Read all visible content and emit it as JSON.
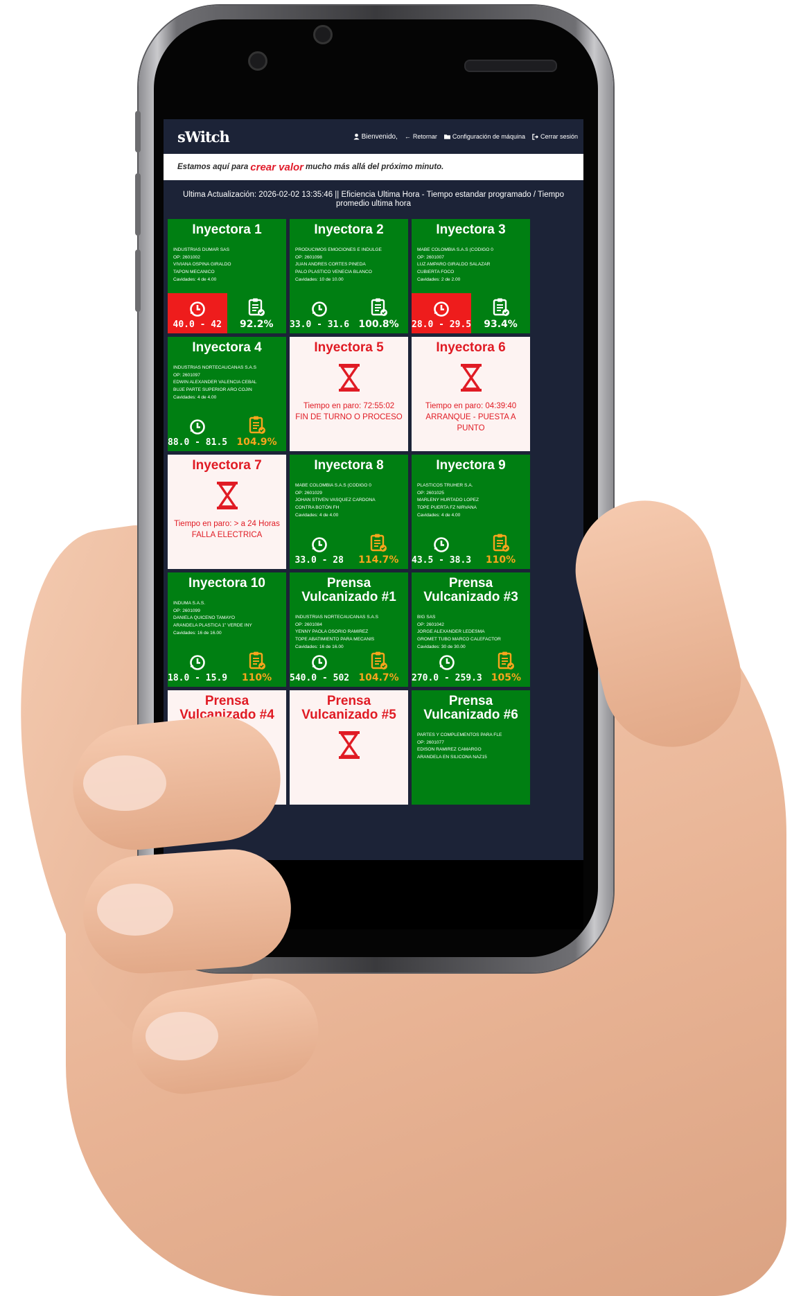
{
  "header": {
    "logo": "sWitch",
    "welcome": "Bienvenido,",
    "back": "Retornar",
    "machine_config": "Configuración de máquina",
    "logout": "Cerrar sesión"
  },
  "slogan": {
    "prefix": "Estamos aquí para",
    "highlight": "crear valor",
    "suffix": "mucho más allá del próximo minuto."
  },
  "update_bar": "Ultima Actualización: 2026-02-02 13:35:46 || Eficiencia Ultima Hora - Tiempo estandar programado / Tiempo promedio ultima hora",
  "colors": {
    "running": "#007f12",
    "alarm": "#ee1c1c",
    "stopped_bg": "#fdf3f2",
    "stopped_text": "#e01b24",
    "efficiency_over": "#f7a51d",
    "navbar": "#1c2337"
  },
  "icons": {
    "user": "user-icon",
    "back": "arrow-left-icon",
    "config": "folder-icon",
    "logout": "logout-icon",
    "time": "clock-icon",
    "efficiency": "clipboard-check-icon",
    "stopped": "hourglass-icon"
  },
  "machines": [
    {
      "name": "Inyectora 1",
      "status": "running",
      "client": "INDUSTRIAS DUMAR SAS",
      "op": "OP: 2601002",
      "operator": "VIVIANA OSPINA GIRALDO",
      "product": "TAPON MECANICO",
      "cavities": "Cavidades: 4 de 4.00",
      "time": "40.0 - 42",
      "time_alarm": true,
      "efficiency": "92.2%",
      "eff_over": false
    },
    {
      "name": "Inyectora 2",
      "status": "running",
      "client": "PRODUCIMOS EMOCIONES E INDULGE",
      "op": "OP: 2601098",
      "operator": "JUAN ANDRES CORTES PINEDA",
      "product": "PALO PLASTICO VENECIA BLANCO",
      "cavities": "Cavidades: 10 de 10.00",
      "time": "33.0 - 31.6",
      "time_alarm": false,
      "efficiency": "100.8%",
      "eff_over": false
    },
    {
      "name": "Inyectora 3",
      "status": "running",
      "client": "MABE COLOMBIA S.A.S (CODIGO 0",
      "op": "OP: 2601007",
      "operator": "LUZ AMPARO GIRALDO SALAZAR",
      "product": "CUBIERTA FOCO",
      "cavities": "Cavidades: 2 de 2.00",
      "time": "28.0 - 29.5",
      "time_alarm": true,
      "efficiency": "93.4%",
      "eff_over": false
    },
    {
      "name": "Inyectora 4",
      "status": "running",
      "client": "INDUSTRIAS NORTECAUCANAS S.A.S",
      "op": "OP: 2601097",
      "operator": "EDWIN ALEXANDER VALENCIA CEBAL",
      "product": "BUJE PARTE SUPERIOR ARO COJIN",
      "cavities": "Cavidades: 4 de 4.00",
      "time": "88.0 - 81.5",
      "time_alarm": false,
      "efficiency": "104.9%",
      "eff_over": true
    },
    {
      "name": "Inyectora 5",
      "status": "stopped",
      "stop_time": "Tiempo en paro: 72:55:02",
      "stop_reason": "FIN DE TURNO O PROCESO"
    },
    {
      "name": "Inyectora 6",
      "status": "stopped",
      "stop_time": "Tiempo en paro: 04:39:40",
      "stop_reason": "ARRANQUE - PUESTA A PUNTO"
    },
    {
      "name": "Inyectora 7",
      "status": "stopped",
      "stop_time": "Tiempo en paro: > a 24 Horas",
      "stop_reason": "FALLA ELECTRICA"
    },
    {
      "name": "Inyectora 8",
      "status": "running",
      "client": "MABE COLOMBIA S.A.S (CODIGO 0",
      "op": "OP: 2601029",
      "operator": "JOHAN STIVEN VASQUEZ CARDONA",
      "product": "CONTRA BOTÓN FH",
      "cavities": "Cavidades: 4 de 4.00",
      "time": "33.0 - 28",
      "time_alarm": false,
      "efficiency": "114.7%",
      "eff_over": true
    },
    {
      "name": "Inyectora 9",
      "status": "running",
      "client": "PLASTICOS TRUHER S.A.",
      "op": "OP: 2601025",
      "operator": "MARLENY HURTADO LOPEZ",
      "product": "TOPE PUERTA FZ NIRVANA",
      "cavities": "Cavidades: 4 de 4.00",
      "time": "43.5 - 38.3",
      "time_alarm": false,
      "efficiency": "110%",
      "eff_over": true
    },
    {
      "name": "Inyectora 10",
      "status": "running",
      "client": "INDUMA S.A.S.",
      "op": "OP: 2601099",
      "operator": "DANIELA QUICENO TAMAYO",
      "product": "ARANDELA PLASTICA 1\" VERDE INY",
      "cavities": "Cavidades: 16 de 16.00",
      "time": "18.0 - 15.9",
      "time_alarm": false,
      "efficiency": "110%",
      "eff_over": true
    },
    {
      "name": "Prensa Vulcanizado #1",
      "status": "running",
      "client": "INDUSTRIAS NORTECAUCANAS S.A.S",
      "op": "OP: 2601084",
      "operator": "YENNY PAOLA OSORIO RAMIREZ",
      "product": "TOPE ABATIMIENTO PARA MECANIS",
      "cavities": "Cavidades: 16 de 16.00",
      "time": "540.0 - 502",
      "time_alarm": false,
      "efficiency": "104.7%",
      "eff_over": true
    },
    {
      "name": "Prensa Vulcanizado #3",
      "status": "running",
      "client": "BIG SAS",
      "op": "OP: 2601042",
      "operator": "JORGE ALEXANDER LEDESMA",
      "product": "GROMET TUBO MARCO CALEFACTOR",
      "cavities": "Cavidades: 30 de 30.00",
      "time": "270.0 - 259.3",
      "time_alarm": false,
      "efficiency": "105%",
      "eff_over": true
    },
    {
      "name": "Prensa Vulcanizado #4",
      "status": "stopped",
      "stop_time": "",
      "stop_reason": ""
    },
    {
      "name": "Prensa Vulcanizado #5",
      "status": "stopped",
      "stop_time": "",
      "stop_reason": ""
    },
    {
      "name": "Prensa Vulcanizado #6",
      "status": "running",
      "client": "PARTES Y COMPLEMENTOS PARA FLE",
      "op": "OP: 2601077",
      "operator": "EDISON RAMIREZ CAMARGO",
      "product": "ARANDELA EN SILICONA NAZ15",
      "cavities": "",
      "time": "",
      "time_alarm": false,
      "efficiency": "",
      "eff_over": false
    }
  ]
}
